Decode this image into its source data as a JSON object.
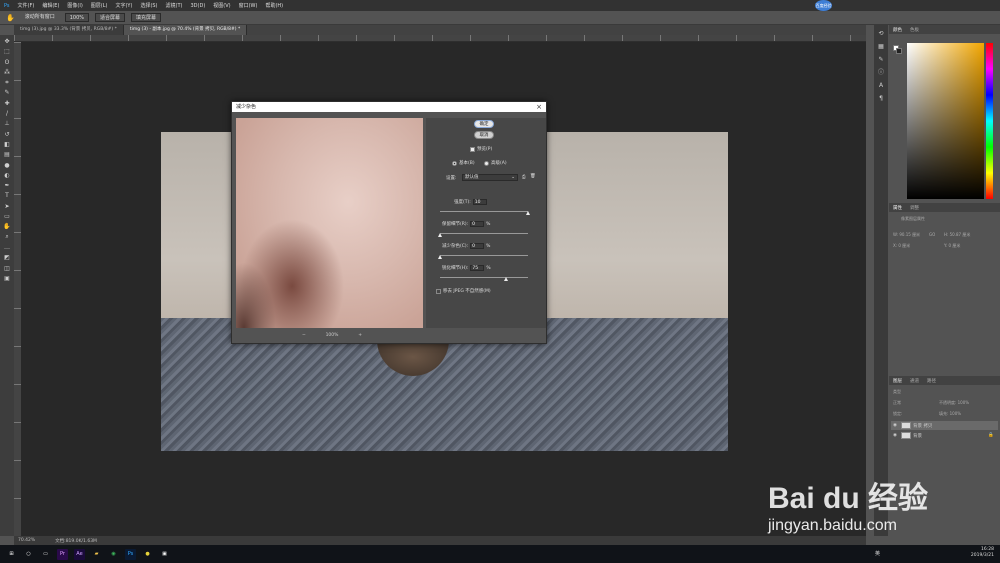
{
  "menubar": {
    "items": [
      "文件(F)",
      "编辑(E)",
      "图像(I)",
      "图层(L)",
      "文字(Y)",
      "选择(S)",
      "滤镜(T)",
      "3D(D)",
      "视图(V)",
      "窗口(W)",
      "帮助(H)"
    ]
  },
  "options": {
    "scroll_all": "滚动所有窗口",
    "zoom": "100%",
    "fit_screen": "适合屏幕",
    "fill_screen": "填充屏幕"
  },
  "tabs": [
    {
      "label": "timg (3).jpg @ 33.3% (背景 拷贝, RGB/8#) *"
    },
    {
      "label": "timg (3) - 副本.jpg @ 70.4% (背景 拷贝, RGB/8#) *"
    }
  ],
  "tools": [
    "move",
    "marquee",
    "lasso",
    "wand",
    "crop",
    "eyedropper",
    "heal",
    "brush",
    "stamp",
    "history",
    "eraser",
    "gradient",
    "blur",
    "dodge",
    "pen",
    "type",
    "path",
    "shape",
    "hand",
    "zoom",
    "more",
    "colors",
    "quickmask",
    "screen"
  ],
  "dialog": {
    "title": "减少杂色",
    "ok": "确定",
    "cancel": "取消",
    "preview_label": "预览(P)",
    "basic_label": "基本(B)",
    "advanced_label": "高级(A)",
    "settings_label": "设置:",
    "settings_value": "默认值",
    "strength_label": "强度(T):",
    "strength_value": "10",
    "preserve_label": "保留细节(R):",
    "preserve_value": "0",
    "preserve_unit": "%",
    "color_noise_label": "减少杂色(C):",
    "color_noise_value": "0",
    "color_noise_unit": "%",
    "sharpen_label": "锐化细节(H):",
    "sharpen_value": "75",
    "sharpen_unit": "%",
    "jpeg_label": "移去 JPEG 不自然感(M)",
    "zoom": "100%",
    "zoom_out": "−",
    "zoom_in": "+"
  },
  "status": {
    "zoom": "70.42%",
    "doc": "文档:819.0K/1.63M"
  },
  "panels": {
    "color_tabs": [
      "颜色",
      "色板"
    ],
    "props_tabs": [
      "属性",
      "调整"
    ],
    "props_subtitle": "像素图层属性",
    "w": "W: 90.15 厘米",
    "h": "H: 50.87 厘米",
    "x": "X: 0 厘米",
    "y": "Y: 0 厘米",
    "go": "GO",
    "layers_tabs": [
      "图层",
      "通道",
      "路径"
    ],
    "kind": "类型",
    "mode": "正常",
    "opacity": "不透明度: 100%",
    "lock": "锁定:",
    "fill": "填充: 100%",
    "layers": [
      {
        "name": "背景 拷贝"
      },
      {
        "name": "背景"
      }
    ]
  },
  "taskbar": {
    "time": "16:28",
    "date": "2019/3/21",
    "ime": "英"
  },
  "watermark": {
    "brand": "Bai du 经验",
    "url": "jingyan.baidu.com"
  },
  "avatar": "百度经验"
}
